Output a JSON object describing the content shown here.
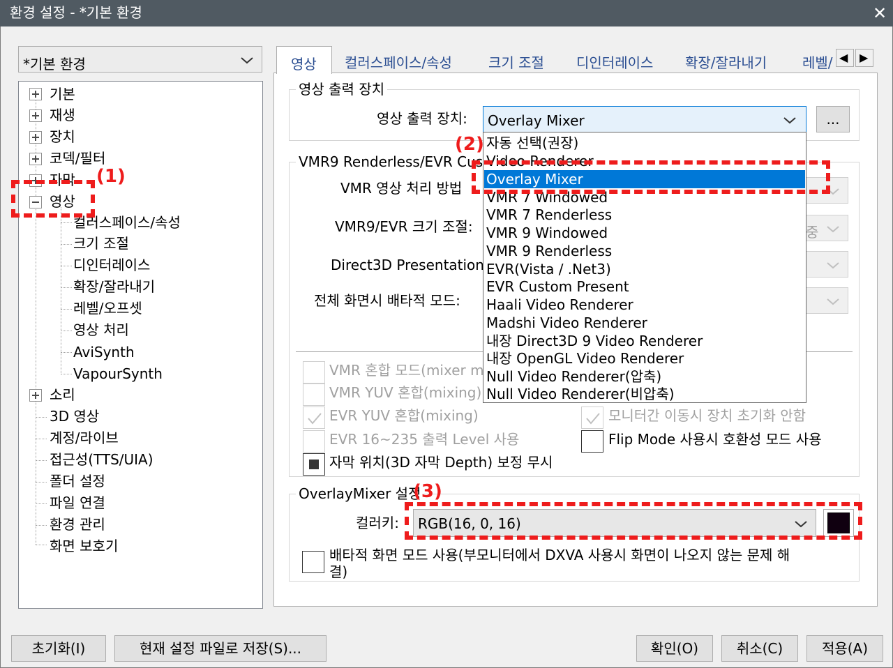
{
  "window": {
    "title": "환경 설정 - *기본 환경",
    "close": "✕"
  },
  "profile": {
    "value": "*기본 환경"
  },
  "tree": {
    "items": [
      {
        "label": "기본"
      },
      {
        "label": "재생"
      },
      {
        "label": "장치"
      },
      {
        "label": "코덱/필터"
      },
      {
        "label": "자막"
      },
      {
        "label": "영상"
      }
    ],
    "video_children": [
      {
        "label": "컬러스페이스/속성"
      },
      {
        "label": "크기 조절"
      },
      {
        "label": "디인터레이스"
      },
      {
        "label": "확장/잘라내기"
      },
      {
        "label": "레벨/오프셋"
      },
      {
        "label": "영상 처리"
      },
      {
        "label": "AviSynth"
      },
      {
        "label": "VapourSynth"
      }
    ],
    "items_after": [
      {
        "label": "소리"
      },
      {
        "label": "3D 영상"
      },
      {
        "label": "계정/라이브"
      },
      {
        "label": "접근성(TTS/UIA)"
      },
      {
        "label": "폴더 설정"
      },
      {
        "label": "파일 연결"
      },
      {
        "label": "환경 관리"
      },
      {
        "label": "화면 보호기"
      }
    ]
  },
  "tabs": [
    {
      "label": "영상"
    },
    {
      "label": "컬러스페이스/속성"
    },
    {
      "label": "크기 조절"
    },
    {
      "label": "디인터레이스"
    },
    {
      "label": "확장/잘라내기"
    },
    {
      "label": "레벨/"
    }
  ],
  "tab_scroll": {
    "left": "◀",
    "right": "▶"
  },
  "output_group": {
    "title": "영상 출력 장치",
    "label": "영상 출력 장치:",
    "value": "Overlay Mixer",
    "browse": "..."
  },
  "dropdown": {
    "options": [
      "자동 선택(권장)",
      "Video Renderer",
      "Overlay Mixer",
      "VMR 7 Windowed",
      "VMR 7 Renderless",
      "VMR 9 Windowed",
      "VMR 9 Renderless",
      "EVR(Vista / .Net3)",
      "EVR Custom Present",
      "Haali Video Renderer",
      "Madshi Video Renderer",
      "내장 Direct3D 9 Video Renderer",
      "내장 OpenGL Video Renderer",
      "Null Video Renderer(압축)",
      "Null Video Renderer(비압축)"
    ],
    "selected_index": 2
  },
  "vmr_group": {
    "title": "VMR9 Renderless/EVR Custo",
    "labels": {
      "mode": "VMR 영상 처리 방법",
      "resize": "VMR9/EVR 크기 조절:",
      "d3d": "Direct3D Presentation:",
      "exclusive": "전체 화면시 배타적 모드:"
    },
    "resize_partial": "중",
    "checks": [
      {
        "label": "VMR 혼합 모드(mixer m",
        "state": "disabled"
      },
      {
        "label": "VMR YUV 혼합(mixing)",
        "state": "disabled"
      },
      {
        "label": "EVR YUV 혼합(mixing)",
        "state": "disabled-checked"
      },
      {
        "label": "EVR 16~235 출력 Level 사용",
        "state": "disabled"
      },
      {
        "label": "자막 위치(3D 자막 Depth) 보정 무시",
        "state": "indeterminate"
      }
    ],
    "right_checks": [
      {
        "label": "모니터간 이동시 장치 초기화 안함",
        "state": "disabled-checked"
      },
      {
        "label": "Flip Mode 사용시 호환성 모드 사용",
        "state": "unchecked"
      }
    ]
  },
  "overlay_group": {
    "title": "OverlayMixer 설정",
    "color_label": "컬러키:",
    "color_value": "RGB(16, 0, 16)",
    "swatch_color": "#100010",
    "exclusive_line1": "배타적 화면 모드 사용(부모니터에서 DXVA 사용시 화면이 나오지 않는 문제 해",
    "exclusive_line2": "결)"
  },
  "buttons": {
    "reset": "초기화(I)",
    "save_as": "현재 설정 파일로 저장(S)...",
    "ok": "확인(O)",
    "cancel": "취소(C)",
    "apply": "적용(A)"
  },
  "annotations": {
    "a1": "(1)",
    "a2": "(2)",
    "a3": "(3)",
    "color": "#ee1c1c"
  }
}
